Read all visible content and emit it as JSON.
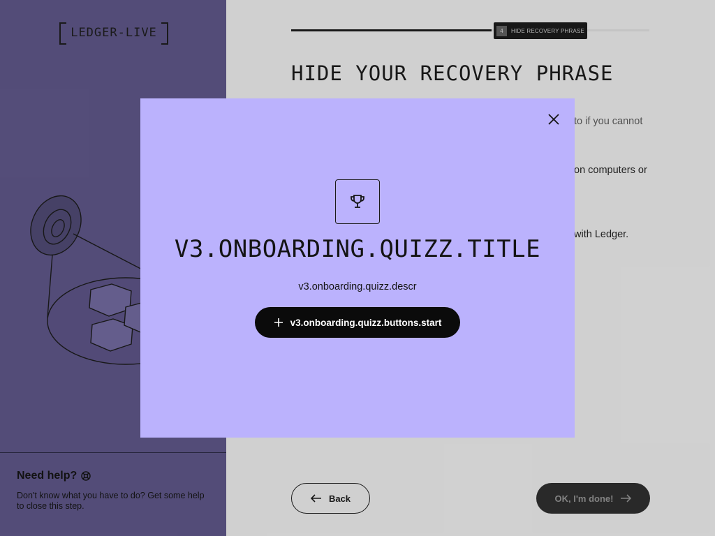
{
  "logo": {
    "text": "LEDGER-LIVE"
  },
  "help": {
    "title": "Need help?",
    "body": "Don't know what you have to do? Get some help to close this step."
  },
  "stepper": {
    "number": "4",
    "label": "HIDE RECOVERY PHRASE",
    "progress": 0.56
  },
  "page": {
    "title": "HIDE YOUR RECOVERY PHRASE",
    "line1": "to if you cannot",
    "line2": "on computers or",
    "line3": "with Ledger."
  },
  "footer": {
    "back_label": "Back",
    "done_label": "OK, I'm done!"
  },
  "modal": {
    "title": "V3.ONBOARDING.QUIZZ.TITLE",
    "descr": "v3.onboarding.quizz.descr",
    "start_label": "v3.onboarding.quizz.buttons.start"
  },
  "colors": {
    "left_panel": "#58517f",
    "modal_bg": "#bbb2fd",
    "primary_btn": "#0b0b0b",
    "background": "#dcdcdc"
  },
  "icons": [
    "trophy-icon",
    "close-icon",
    "plus-icon",
    "arrow-left-icon",
    "arrow-right-icon",
    "help-circle-icon"
  ]
}
